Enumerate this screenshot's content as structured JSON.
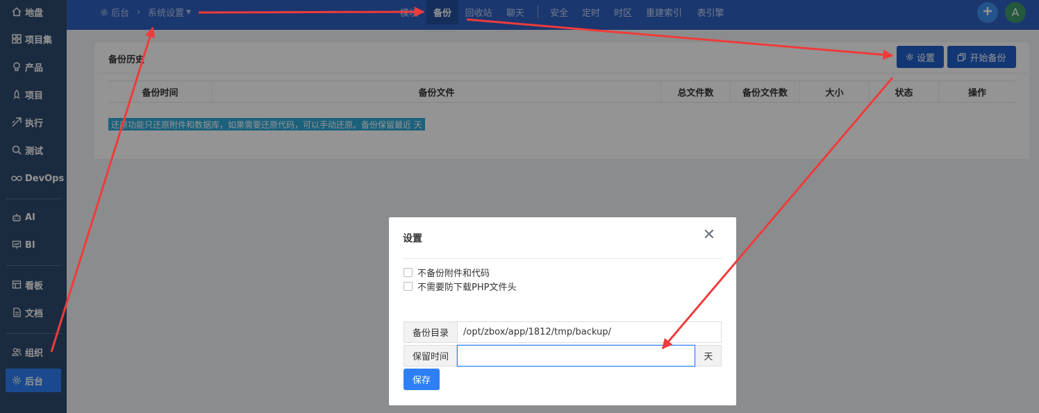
{
  "sidebar": {
    "items": [
      {
        "label": "地盘",
        "icon": "home-icon"
      },
      {
        "label": "项目集",
        "icon": "grid-icon"
      },
      {
        "label": "产品",
        "icon": "bulb-icon"
      },
      {
        "label": "项目",
        "icon": "rocket-icon"
      },
      {
        "label": "执行",
        "icon": "send-icon"
      },
      {
        "label": "测试",
        "icon": "search-icon"
      },
      {
        "label": "DevOps",
        "icon": "infinity-icon"
      },
      {
        "label": "AI",
        "icon": "robot-icon"
      },
      {
        "label": "BI",
        "icon": "chart-icon"
      },
      {
        "label": "看板",
        "icon": "board-icon"
      },
      {
        "label": "文档",
        "icon": "document-icon"
      },
      {
        "label": "组织",
        "icon": "users-icon"
      },
      {
        "label": "后台",
        "icon": "gear-icon"
      }
    ]
  },
  "topbar": {
    "breadcrumb_home": "后台",
    "breadcrumb_current": "系统设置",
    "tabs": [
      "备份",
      "回收站",
      "聊天",
      "安全",
      "定时",
      "时区",
      "重建索引",
      "表引擎"
    ],
    "partial_tab": "模块",
    "avatar_letter": "A"
  },
  "panel": {
    "title": "备份历史",
    "settings_button": "设置",
    "start_backup_button": "开始备份",
    "columns": [
      "备份时间",
      "备份文件",
      "总文件数",
      "备份文件数",
      "大小",
      "状态",
      "操作"
    ],
    "note": "还原功能只还原附件和数据库，如果需要还原代码，可以手动还原。备份保留最近 天"
  },
  "modal": {
    "title": "设置",
    "options": [
      "不备份附件和代码",
      "不需要防下载PHP文件头"
    ],
    "backup_dir_label": "备份目录",
    "backup_dir_value": "/opt/zbox/app/1812/tmp/backup/",
    "retention_label": "保留时间",
    "retention_value": "",
    "retention_suffix": "天",
    "save_button": "保存"
  },
  "colors": {
    "sidebar_bg": "#2f4a6d",
    "topbar_bg": "#2f5fc0",
    "accent": "#2e7ff5",
    "annotation_arrow": "#ef3b3b"
  }
}
